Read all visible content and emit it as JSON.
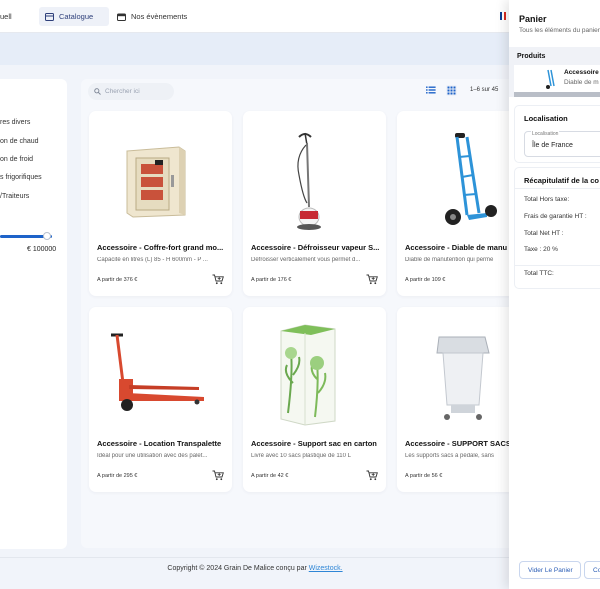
{
  "nav": {
    "items": [
      {
        "label": "uell",
        "icon": "home-icon"
      },
      {
        "label": "Catalogue",
        "icon": "catalogue-icon",
        "active": true
      },
      {
        "label": "Nos évènements",
        "icon": "calendar-icon"
      }
    ],
    "language_flag": "french-flag-icon"
  },
  "filters": {
    "items": [
      "res divers",
      "on de chaud",
      "on de froid",
      "s frigorifiques",
      "/Traiteurs"
    ],
    "price_max": "€ 100000"
  },
  "catalogue": {
    "search_placeholder": "Chercher ici",
    "pagination": "1–6 sur 45",
    "products": [
      {
        "title": "Accessoire - Coffre-fort grand mo...",
        "description": "Capacité en litres (L) 85 - H 600mm - P ...",
        "price": "A partir de 376 €"
      },
      {
        "title": "Accessoire - Défroisseur vapeur S...",
        "description": "Défroisser verticalement vous permet d...",
        "price": "A partir de 176 €"
      },
      {
        "title": "Accessoire - Diable de manu",
        "description": "Diable de manutention qui perme",
        "price": "A partir de 109 €"
      },
      {
        "title": "Accessoire - Location Transpalette",
        "description": "Idéal pour une utilisation avec des palet...",
        "price": "A partir de 295 €"
      },
      {
        "title": "Accessoire - Support sac en carton",
        "description": "Livré avec 10 sacs plastique de 110 L",
        "price": "A partir de 42 €"
      },
      {
        "title": "Accessoire - SUPPORT SACS A",
        "description": "Les supports sacs à pédale, sans",
        "price": "A partir de 56 €"
      }
    ]
  },
  "footer": {
    "text": "Copyright © 2024 Grain De Malice conçu par ",
    "link": "Wizestock."
  },
  "cart": {
    "title": "Panier",
    "subtitle": "Tous les éléments du panier",
    "products_heading": "Produits",
    "item_name": "Accessoire",
    "item_desc": "Diable de m",
    "location_heading": "Localisation",
    "location_label": "Localisation",
    "location_value": "Île de France",
    "summary_heading": "Récapitulatif de la co",
    "summary_rows": [
      "Total Hors taxe:",
      "Frais de garantie HT :",
      "Total Net HT :",
      "Taxe : 20 %",
      "Total TTC:"
    ],
    "clear_button": "Vider Le Panier",
    "continue_button": "Con"
  },
  "colors": {
    "accent": "#1e63c9",
    "background": "#f1f4fa",
    "link": "#2f86d6",
    "cart_red": "#d64b2b"
  }
}
